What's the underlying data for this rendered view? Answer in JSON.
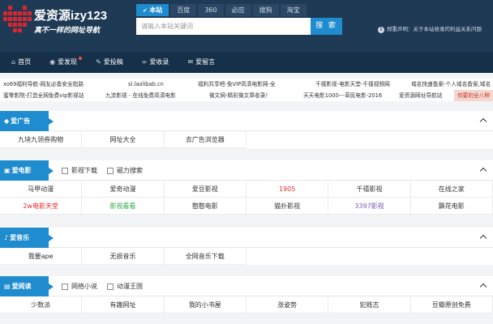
{
  "header": {
    "site_title": "爱资源izy123",
    "slogan": "真不一样的网址导航",
    "engines": [
      "本站",
      "百度",
      "360",
      "必应",
      "搜狗",
      "淘宝"
    ],
    "search_placeholder": "请输入本站关键词",
    "search_button": "搜 索",
    "disclaimer": "郑重声明：关于本站收录的利益关系问题"
  },
  "nav": {
    "items": [
      "首页",
      "爱发现",
      "爱投稿",
      "爱收录",
      "爱留言"
    ]
  },
  "ticker": {
    "row1": [
      "xo69福利导航-网友必备安全指路",
      "sl.laolibab.cn",
      "福利共享吧-免VIP高清电影网-全",
      "千禧影视-电影天堂-千禧视频网",
      "域名快速备案-个人域名备案,域名"
    ],
    "row2": [
      "蜜零影院-打造全网免费vip影视站",
      "九流影视 - 在线免费高清电影",
      "微文网-精彩微文章收录！",
      "天天电影1000---草民电影-2016",
      "爱资源网址导航站",
      "你要的全八种"
    ]
  },
  "sections": {
    "ads": {
      "title": "爱广告",
      "cells": [
        "九块九领券购物",
        "网址大全",
        "去广告浏览器"
      ]
    },
    "movie": {
      "title": "爱电影",
      "tabs": [
        "影视下载",
        "磁力搜索"
      ],
      "cells": [
        "马甲动漫",
        "爱奇动漫",
        "爱豆影视",
        "1905",
        "千禧影视",
        "在线之家",
        "2w电影天堂",
        "影视看看",
        "憨憨电影",
        "猫扑影视",
        "3397影视",
        "飘花电影"
      ]
    },
    "music": {
      "title": "爱音乐",
      "cells": [
        "我要ape",
        "无损音乐",
        "全网音乐下载"
      ]
    },
    "read": {
      "title": "爱阅读",
      "tabs": [
        "网络小说",
        "动漫王国"
      ],
      "cells": [
        "少数派",
        "有趣网址",
        "我的小书屋",
        "涨姿势",
        "犯贱志",
        "豆瓣原创免费"
      ]
    }
  },
  "colors": {
    "header_bg": "#1e3a55",
    "nav_bg": "#16304a",
    "accent": "#1f8ccf",
    "logo_red": "#d9262f"
  }
}
